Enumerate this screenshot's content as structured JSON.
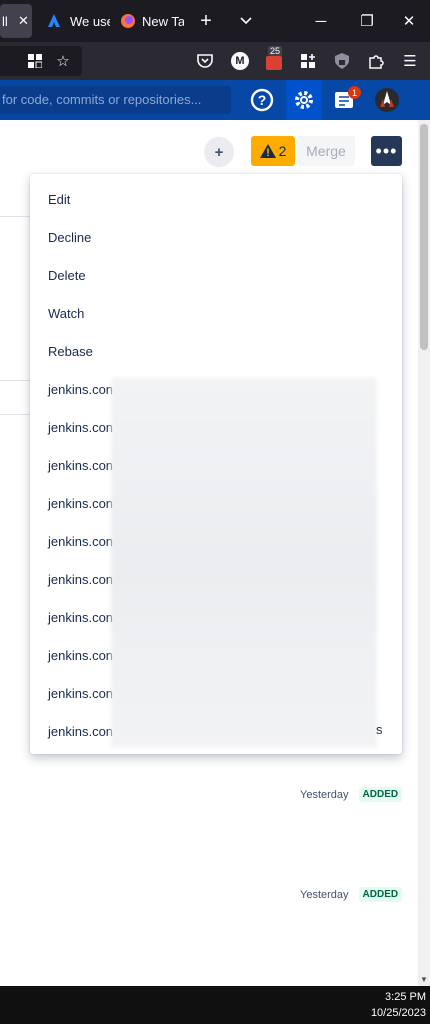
{
  "browser": {
    "tabs": [
      {
        "label": "ll",
        "active": true
      },
      {
        "label": "We use"
      },
      {
        "label": "New Ta"
      }
    ],
    "extension_badge": "25",
    "notification_badge": "1"
  },
  "search": {
    "placeholder": "for code, commits or repositories..."
  },
  "toolbar": {
    "plus_label": "+",
    "warning_count": "2",
    "merge_label": "Merge",
    "more_label": "•••"
  },
  "menu": {
    "items": [
      "Edit",
      "Decline",
      "Delete",
      "Watch",
      "Rebase",
      "jenkins.con",
      "jenkins.con",
      "jenkins.con",
      "jenkins.con",
      "jenkins.con",
      "jenkins.con",
      "jenkins.con",
      "jenkins.con",
      "jenkins.con",
      "jenkins.con"
    ],
    "last_suffix": "s"
  },
  "rows": [
    {
      "time": "Yesterday",
      "status": "ADDED"
    },
    {
      "time": "Yesterday",
      "status": "ADDED"
    }
  ],
  "clock": {
    "time": "3:25 PM",
    "date": "10/25/2023"
  },
  "colors": {
    "app_bar": "#0747a6",
    "warning": "#ffab00",
    "added_text": "#006644",
    "added_bg": "#e3fcef"
  }
}
